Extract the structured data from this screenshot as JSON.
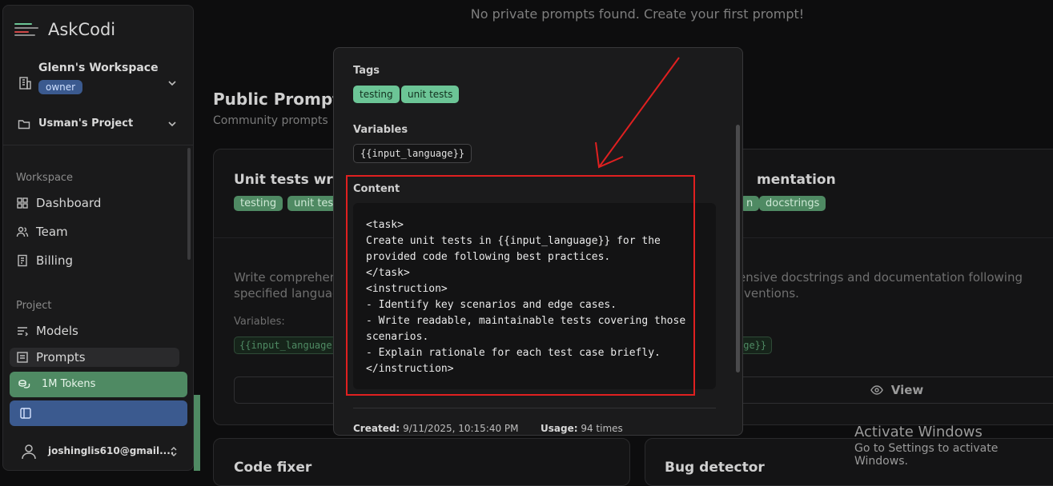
{
  "sidebar": {
    "app_name": "AskCodi",
    "workspace_name": "Glenn's Workspace",
    "workspace_role": "owner",
    "project_name": "Usman's Project",
    "section_workspace": "Workspace",
    "section_project": "Project",
    "workspace_items": [
      {
        "label": "Dashboard",
        "icon": "dashboard-icon"
      },
      {
        "label": "Team",
        "icon": "team-icon"
      },
      {
        "label": "Billing",
        "icon": "billing-icon"
      }
    ],
    "project_items": [
      {
        "label": "Models",
        "icon": "models-icon"
      },
      {
        "label": "Prompts",
        "icon": "prompts-icon",
        "active": true
      }
    ],
    "tokens_label": "1M Tokens",
    "user_email": "joshinglis610@gmail...."
  },
  "main": {
    "empty_private": "No private prompts found. Create your first prompt!",
    "public_title": "Public Prompts",
    "public_subtitle": "Community prompts",
    "cards": [
      {
        "title": "Unit tests write",
        "tags": [
          "testing",
          "unit test"
        ],
        "description_line1": "Write comprehen",
        "description_line2": "specified languag",
        "variables_label": "Variables:",
        "variable": "{{input_language}}"
      },
      {
        "title": "mentation",
        "tags": [
          "n",
          "docstrings"
        ],
        "description_line1": "ensive docstrings and documentation following",
        "description_line2": "ventions.",
        "variable": "age}}",
        "view_label": "View"
      },
      {
        "title": "Code fixer"
      },
      {
        "title": "Bug detector"
      }
    ]
  },
  "modal": {
    "tags_label": "Tags",
    "tags": [
      "testing",
      "unit tests"
    ],
    "variables_label": "Variables",
    "variable": "{{input_language}}",
    "content_label": "Content",
    "content_lines": [
      "<task>",
      "Create unit tests in {{input_language}} for the",
      "provided code following best practices.",
      "</task>",
      "<instruction>",
      "- Identify key scenarios and edge cases.",
      "- Write readable, maintainable tests covering those",
      "scenarios.",
      "- Explain rationale for each test case briefly.",
      "</instruction>"
    ],
    "created_label": "Created:",
    "created_value": "9/11/2025, 10:15:40 PM",
    "usage_label": "Usage:",
    "usage_value": "94 times"
  },
  "overlay": {
    "activate_title": "Activate Windows",
    "activate_sub": "Go to Settings to activate Windows."
  },
  "colors": {
    "accent_green": "#4f8a63",
    "accent_blue": "#3b5a8f",
    "annotation_red": "#e02020"
  }
}
